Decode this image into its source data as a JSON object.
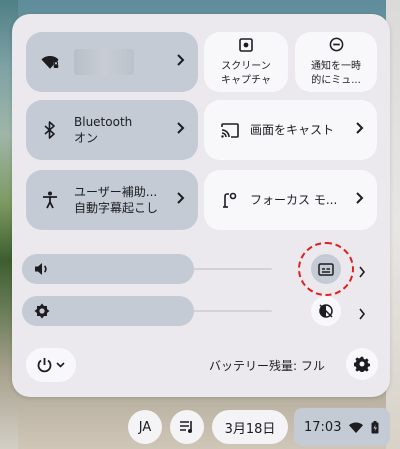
{
  "quick_settings": {
    "network": {
      "label": "",
      "state": "on",
      "icon": "wifi-locked-icon"
    },
    "bluetooth": {
      "title": "Bluetooth",
      "status": "オン",
      "icon": "bluetooth-icon"
    },
    "accessibility": {
      "title": "ユーザー補助...",
      "status": "自動字幕起こし",
      "icon": "accessibility-icon"
    },
    "screen_capture": {
      "line1": "スクリーン",
      "line2": "キャプチャ",
      "icon": "screen-capture-icon"
    },
    "dnd": {
      "line1": "通知を一時",
      "line2": "的にミュ...",
      "icon": "do-not-disturb-icon"
    },
    "cast": {
      "label": "画面をキャスト",
      "icon": "cast-icon"
    },
    "focus": {
      "label": "フォーカス モ...",
      "icon": "focus-mode-icon"
    }
  },
  "sliders": {
    "volume": {
      "icon": "volume-icon",
      "level": 0.0
    },
    "brightness": {
      "icon": "brightness-icon",
      "level": 0.0
    },
    "live_caption_icon": "live-caption-icon",
    "night_light_icon": "night-light-off-icon"
  },
  "footer": {
    "battery_label": "バッテリー残量: フル",
    "power_icon": "power-icon",
    "settings_icon": "gear-icon"
  },
  "shelf": {
    "ime": "JA",
    "date": "3月18日",
    "time": "17:03"
  },
  "colors": {
    "panel_bg": "#ebe9ed",
    "tile_on": "#c4cbd5",
    "tile_off": "#f8f8fb",
    "highlight_ring": "#e02020"
  }
}
